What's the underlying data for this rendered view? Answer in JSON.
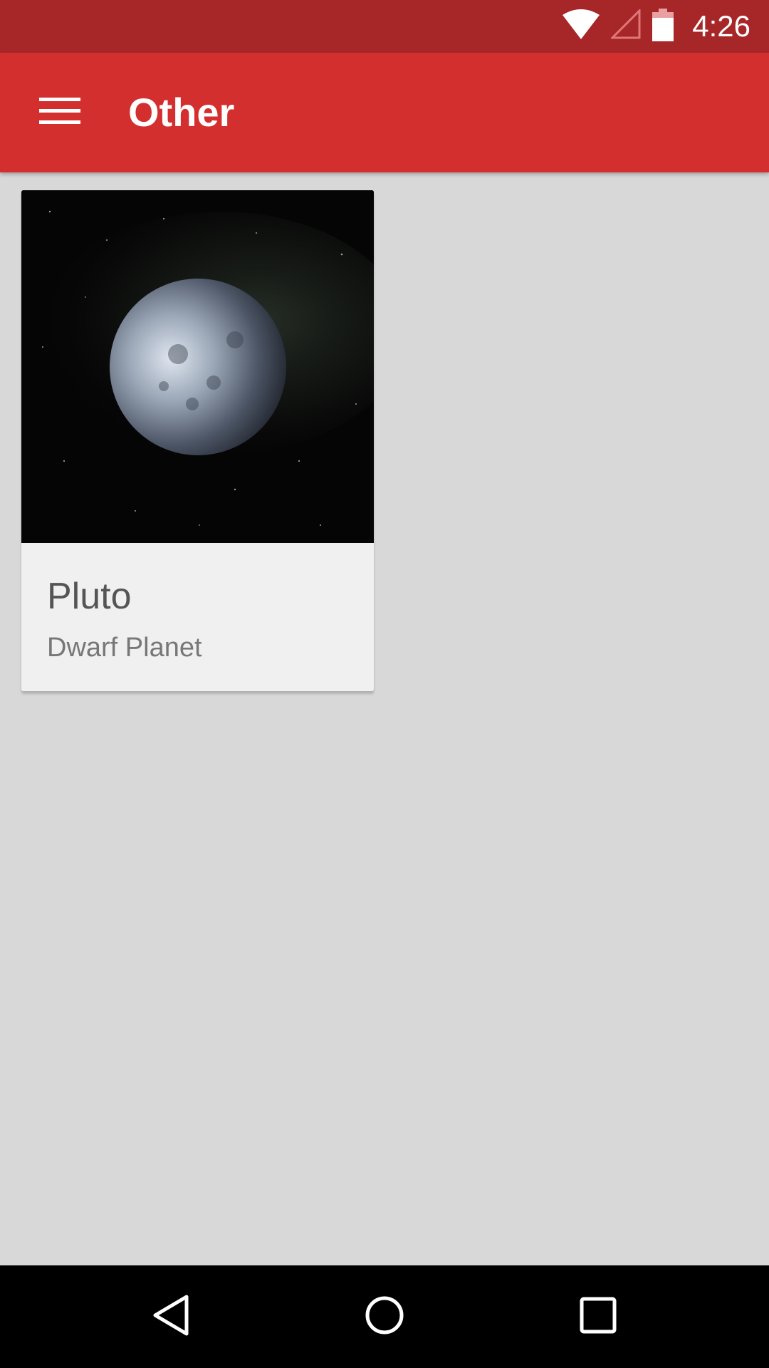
{
  "status_bar": {
    "time": "4:26",
    "icons": [
      "wifi-icon",
      "cellular-signal-icon",
      "battery-icon"
    ]
  },
  "app_bar": {
    "menu_icon": "hamburger-menu-icon",
    "title": "Other"
  },
  "cards": [
    {
      "image": "pluto-image",
      "title": "Pluto",
      "subtitle": "Dwarf Planet"
    }
  ],
  "nav_bar": {
    "icons": [
      "back-icon",
      "home-icon",
      "recents-icon"
    ]
  },
  "colors": {
    "status_bar": "#a72628",
    "app_bar": "#d42f2f",
    "background": "#d8d8d8",
    "card": "#f0f0f0",
    "nav_bar": "#000000"
  }
}
